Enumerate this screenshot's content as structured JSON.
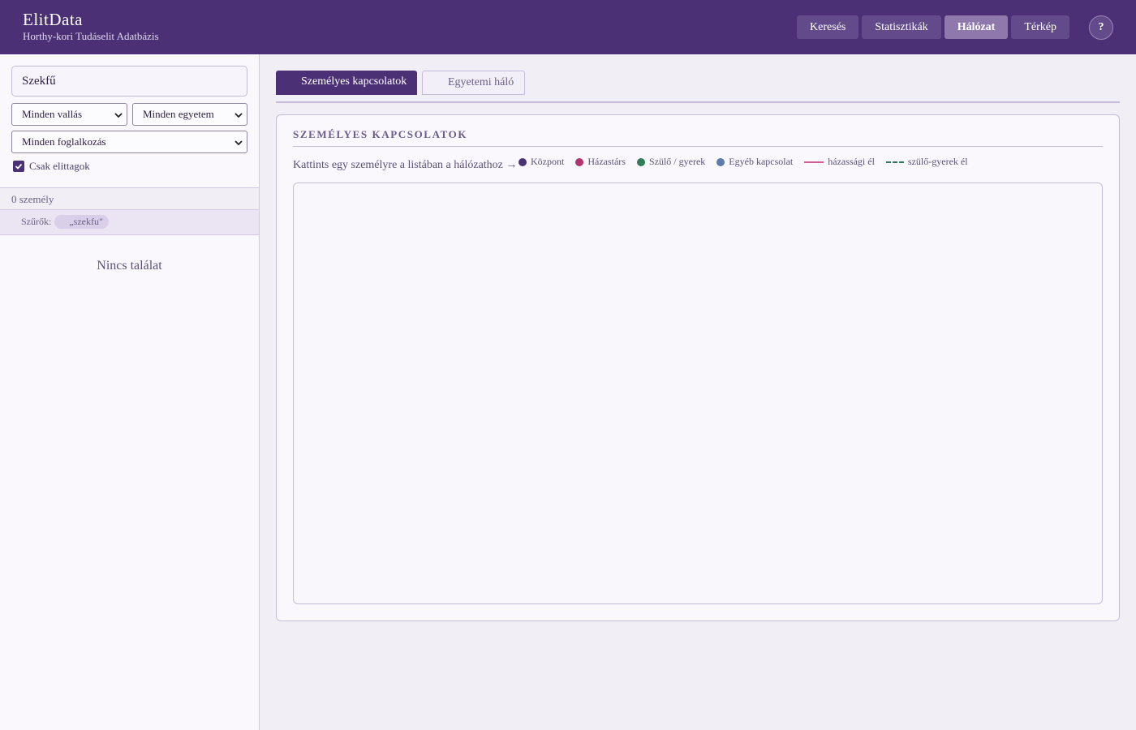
{
  "app": {
    "title": "ElitData",
    "subtitle": "Horthy-kori Tudáselit Adatbázis"
  },
  "nav": {
    "items": [
      {
        "label": "Keresés",
        "active": false
      },
      {
        "label": "Statisztikák",
        "active": false
      },
      {
        "label": "Hálózat",
        "active": true
      },
      {
        "label": "Térkép",
        "active": false
      }
    ],
    "help_label": "?"
  },
  "sidebar": {
    "search_value": "Szekfű",
    "religion_select": "Minden vallás",
    "university_select": "Minden egyetem",
    "occupation_select": "Minden foglalkozás",
    "elite_checkbox": {
      "label": "Csak elittagok",
      "checked": true
    },
    "result_count": "0 személy",
    "filters_label": "Szűrők:",
    "filter_chip": "„szekfu\"",
    "empty_text": "Nincs találat"
  },
  "main": {
    "tabs": [
      {
        "label": "Személyes kapcsolatok",
        "active": true
      },
      {
        "label": "Egyetemi háló",
        "active": false
      }
    ],
    "panel_title": "SZEMÉLYES KAPCSOLATOK",
    "hint": "Kattints egy személyre a listában a hálózathoz →",
    "legend": [
      {
        "label": "Központ",
        "color": "#4b3075",
        "kind": "dot"
      },
      {
        "label": "Házastárs",
        "color": "#b3336e",
        "kind": "dot"
      },
      {
        "label": "Szülő / gyerek",
        "color": "#2e7d55",
        "kind": "dot"
      },
      {
        "label": "Egyéb kapcsolat",
        "color": "#5b7bab",
        "kind": "dot"
      },
      {
        "label": "házassági él",
        "color": "#d45c9a",
        "kind": "line"
      },
      {
        "label": "szülő-gyerek él",
        "color": "#2e7d55",
        "kind": "dashed"
      }
    ]
  },
  "colors": {
    "header_bg": "#4b3075",
    "accent": "#4b3075",
    "panel_border": "#c6bcd9"
  }
}
